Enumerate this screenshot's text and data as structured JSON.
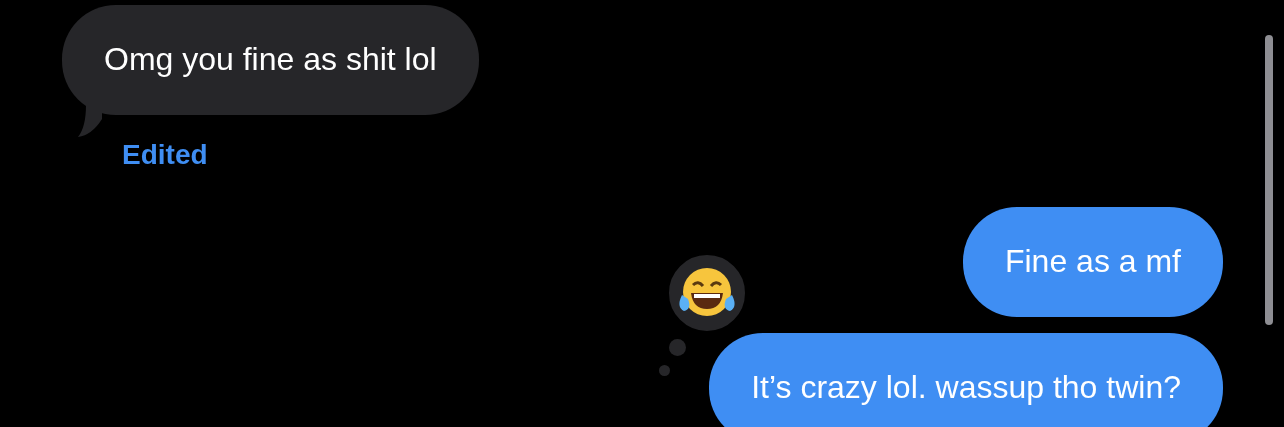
{
  "messages": [
    {
      "kind": "incoming",
      "text": "Omg you fine as shit lol",
      "note": "Edited"
    },
    {
      "kind": "outgoing",
      "text": "Fine as a mf"
    },
    {
      "kind": "outgoing",
      "text": "It’s crazy lol. wassup tho twin?",
      "tapback": {
        "kind": "laugh"
      }
    }
  ]
}
